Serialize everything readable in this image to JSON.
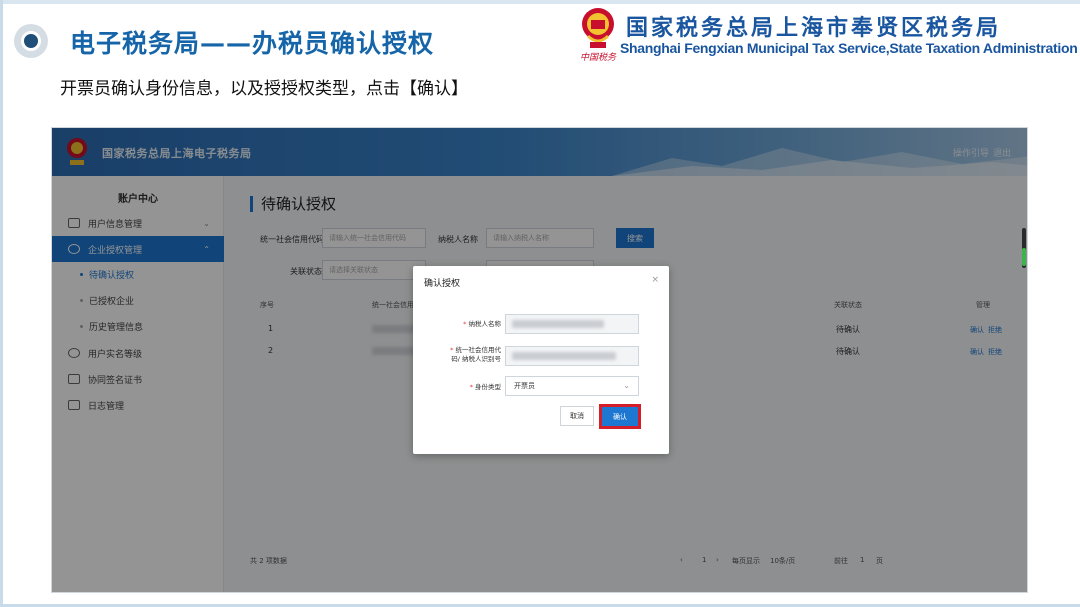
{
  "slide": {
    "title": "电子税务局——办税员确认授权",
    "subtitle": "开票员确认身份信息，以及授授权类型，点击【确认】",
    "org_name_cn": "国家税务总局上海市奉贤区税务局",
    "org_name_en": "Shanghai Fengxian Municipal Tax Service,State Taxation Administration",
    "org_seal_text": "中国税务"
  },
  "app": {
    "title": "国家税务总局上海电子税务局",
    "help_label": "操作引导",
    "exit_label": "退出"
  },
  "sidebar": {
    "title": "账户中心",
    "items": [
      {
        "label": "用户信息管理",
        "icon": "user-card-icon",
        "has_chevron": true
      },
      {
        "label": "企业授权管理",
        "icon": "check-circle-icon",
        "has_chevron": true,
        "active": true
      },
      {
        "label": "用户实名等级",
        "icon": "person-icon"
      },
      {
        "label": "协同签名证书",
        "icon": "certificate-icon"
      },
      {
        "label": "日志管理",
        "icon": "log-icon"
      }
    ],
    "subitems": [
      {
        "label": "待确认授权",
        "current": true
      },
      {
        "label": "已授权企业"
      },
      {
        "label": "历史管理信息"
      }
    ]
  },
  "main": {
    "page_title": "待确认授权",
    "filters": {
      "credit_code_label": "统一社会信用代码",
      "credit_code_placeholder": "请输入统一社会信用代码",
      "taxpayer_name_label": "纳税人名称",
      "taxpayer_name_placeholder": "请输入纳税人名称",
      "status_label": "关联状态",
      "status_placeholder": "请选择关联状态",
      "query_label": "搜索"
    },
    "table": {
      "headers": [
        "序号",
        "统一社会信用代码",
        "关联状态",
        "管理"
      ],
      "rows": [
        {
          "index": "1",
          "status": "待确认",
          "actions": [
            "确认",
            "拒绝"
          ]
        },
        {
          "index": "2",
          "status": "待确认",
          "actions": [
            "确认",
            "拒绝"
          ]
        }
      ]
    },
    "footer": {
      "total": "共 2 项数据",
      "page": "1",
      "per_page_label": "每页显示",
      "per_page_value": "10条/页",
      "goto_label": "前往",
      "goto_value": "1",
      "page_unit": "页"
    }
  },
  "modal": {
    "title": "确认授权",
    "close_symbol": "×",
    "name_label": "纳税人名称",
    "code_label_line1": "统一社会信用代",
    "code_label_line2": "码/ 纳税人识别号",
    "identity_label": "身份类型",
    "identity_value": "开票员",
    "cancel_label": "取消",
    "confirm_label": "确认",
    "highlight_color": "#d41f2a"
  }
}
